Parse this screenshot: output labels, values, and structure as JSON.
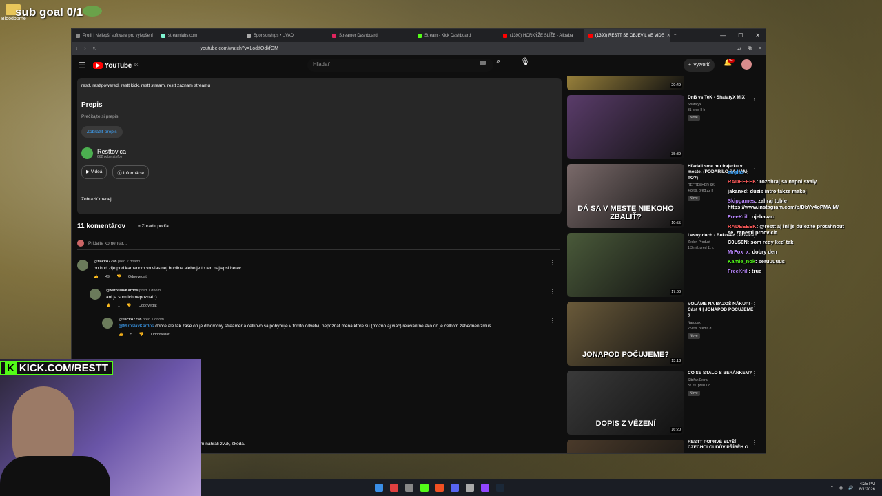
{
  "desktop": {
    "icon_label": "Bloodborne",
    "sub_goal": "sub goal 0/1"
  },
  "browser": {
    "tabs": [
      {
        "label": "Profil | Nejlepší software pro vylepšení",
        "color": "#888888"
      },
      {
        "label": "streamlabs.com",
        "color": "#80f5d2"
      },
      {
        "label": "Sponsorships • UVAD",
        "color": "#aaaaaa"
      },
      {
        "label": "Streamer Dashboard",
        "color": "#e0245e"
      },
      {
        "label": "Stream - Kick Dashboard",
        "color": "#53fc18"
      },
      {
        "label": "(1390) HORKÝŽE SLÍŽE - Alibaba",
        "color": "#ff0000"
      },
      {
        "label": "(1390) RESTT SE OBJEVIL VE VIDE",
        "color": "#ff0000"
      }
    ],
    "url": "youtube.com/watch?v=LodtfOdkfGM"
  },
  "youtube": {
    "logo_text": "YouTube",
    "logo_sup": "SK",
    "search_placeholder": "Hľadať",
    "create_label": "Vytvoriť",
    "bell_badge": "9+"
  },
  "description": {
    "tags": "restt, resttpowered, restt kick, restt stream, restt záznam streamu",
    "transcript_heading": "Prepis",
    "transcript_sub": "Prečítajte si prepis.",
    "show_transcript": "Zobraziť prepis",
    "channel_name": "Resttovica",
    "channel_subs": "662 odberateľov",
    "videos_btn": "Videá",
    "info_btn": "Informácie",
    "show_less": "Zobraziť menej"
  },
  "comments": {
    "count_label": "11 komentárov",
    "sort_label": "Zoradiť podľa",
    "add_placeholder": "Pridajte komentár...",
    "items": [
      {
        "author": "@flacko7798",
        "time": "pred 2 dňami",
        "text": "on bud zije pod kamenom vo vlastnej bubline alebo je to ten najlepsi herec",
        "likes": "49",
        "reply": "Odpovedať",
        "mention": ""
      },
      {
        "author": "@MiroslavKardos",
        "time": "pred 1 dňom",
        "text": "ani ja som ich nepoznal :)",
        "likes": "1",
        "reply": "Odpovedať",
        "mention": ""
      },
      {
        "author": "@flacko7798",
        "time": "pred 1 dňom",
        "text": "dobre ale tak zase on je dlhorocny streamer a celkovo sa pohybuje v tomto odvetvi, nepoznat mena ktore su (mozno aj viac) relevantne ako on je celkom zabednenizmus",
        "likes": "5",
        "reply": "Odpovedať",
        "mention": "@MiroslavKardos"
      }
    ],
    "partial_text": "m nahrali zvuk, škoda."
  },
  "sidebar": {
    "videos": [
      {
        "title": "",
        "channel": "",
        "stats": "",
        "duration": "29:49",
        "thumb_text": "",
        "thumb_color": "#c9a94a",
        "new": ""
      },
      {
        "title": "DnB vs TeK - ShafatyX MiX",
        "channel": "Shafatyx",
        "stats": "31  pred 8 h",
        "duration": "35:39",
        "thumb_text": "",
        "thumb_color": "#5a3c6a",
        "new": "Nové"
      },
      {
        "title": "Hľadali sme mu frajerku v meste. (PODARILO SA NÁM TO?)",
        "channel": "REFRESHER SK",
        "stats": "4,8 tis.  pred 22 h",
        "duration": "10:55",
        "thumb_text": "DÁ SA V MESTE NIEKOHO ZBALIŤ?",
        "thumb_color": "#7a6a6a",
        "new": "Nové"
      },
      {
        "title": "Lesny duch - Bukovec - Kosice",
        "channel": "Zeden Product",
        "stats": "1,3 mil.  pred 11 r.",
        "duration": "17:00",
        "thumb_text": "",
        "thumb_color": "#4a5a3a",
        "new": ""
      },
      {
        "title": "VOLÁME NA BAZOŠ NÁKUP! - Část 4 | JONAPOD POČUJEME ?",
        "channel": "Nardosk",
        "stats": "2,9 tis.  pred 6 d.",
        "duration": "13:13",
        "thumb_text": "JONAPOD POČUJEME?",
        "thumb_color": "#6a5a3a",
        "new": "Nové"
      },
      {
        "title": "CO SE STALO S BERÁNKEM?",
        "channel": "Sibiřan Extra",
        "stats": "37 tis.  pred 1 d.",
        "duration": "16:20",
        "thumb_text": "DOPIS Z VĚZENÍ",
        "thumb_color": "#3a3a3a",
        "new": "Nové"
      },
      {
        "title": "RESTT POPRVÉ SLYŠÍ CZECHCLOUDŮV PŘÍBĚH O",
        "channel": "",
        "stats": "",
        "duration": "",
        "thumb_text": "",
        "thumb_color": "#4a3a2a",
        "new": ""
      }
    ]
  },
  "chat": [
    {
      "user": "anglas_",
      "msg": "",
      "color": "#3ea6ff"
    },
    {
      "user": "RADEEEEK",
      "msg": "rozohraj sa napni svaly",
      "color": "#ff5a5a"
    },
    {
      "user": "jakanxd",
      "msg": "dúzis intro takze makej",
      "color": "#ffffff"
    },
    {
      "user": "Skipgames",
      "msg": "zahraj toble https://www.instagram.com/p/DbYv4oPMAiM/",
      "color": "#bb88ff"
    },
    {
      "user": "FreeKrill",
      "msg": "ojebavac",
      "color": "#bb88ff"
    },
    {
      "user": "RADEEEEK",
      "msg": "@restt aj ini je dulezite protahnout se, zapesti procvicit",
      "color": "#ff5a5a"
    },
    {
      "user": "C0LS0N",
      "msg": "som redy keď tak",
      "color": "#ffffff"
    },
    {
      "user": "MrFox_x",
      "msg": "dobry den",
      "color": "#bb88ff"
    },
    {
      "user": "Kamie_nok",
      "msg": "seruuuuus",
      "color": "#53fc18"
    },
    {
      "user": "FreeKrill",
      "msg": "true",
      "color": "#bb88ff"
    }
  ],
  "overlay": {
    "kick_label": "KICK.COM/RESTT",
    "kick_k": "K"
  },
  "taskbar": {
    "time": "4:25 PM",
    "date": "8/1/2026",
    "icon_colors": [
      "#3a8ee6",
      "#e04040",
      "#888888",
      "#53fc18",
      "#f25022",
      "#5865f2",
      "#aaaaaa",
      "#9146ff",
      "#1b2838"
    ]
  }
}
